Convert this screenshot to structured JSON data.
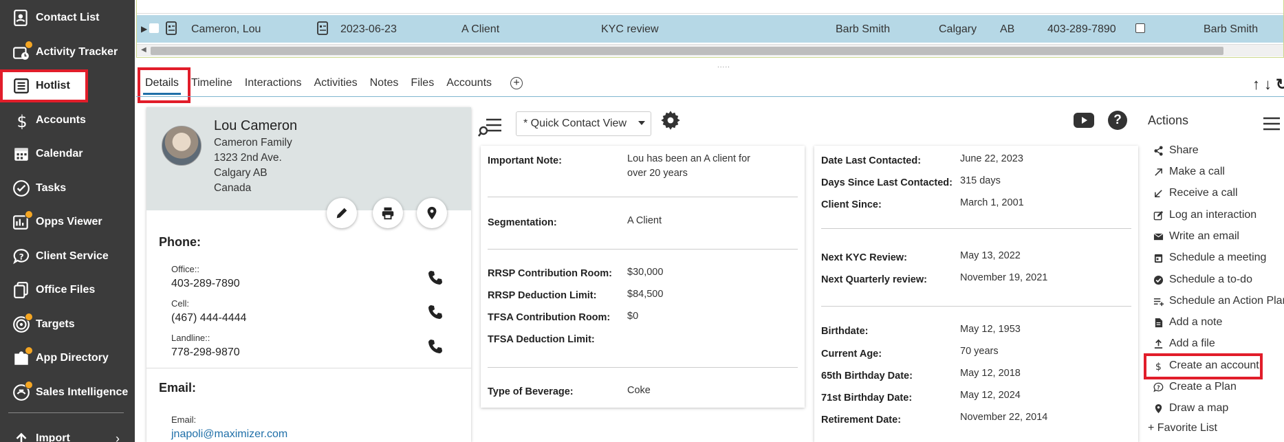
{
  "sidebar": {
    "items": [
      {
        "label": "Contact List",
        "icon": "contact-list-icon"
      },
      {
        "label": "Activity Tracker",
        "icon": "activity-tracker-icon"
      },
      {
        "label": "Hotlist",
        "icon": "hotlist-icon"
      },
      {
        "label": "Accounts",
        "icon": "dollar-icon"
      },
      {
        "label": "Calendar",
        "icon": "calendar-icon"
      },
      {
        "label": "Tasks",
        "icon": "check-circle-icon"
      },
      {
        "label": "Opps Viewer",
        "icon": "opps-viewer-icon"
      },
      {
        "label": "Client Service",
        "icon": "client-service-icon"
      },
      {
        "label": "Office Files",
        "icon": "office-files-icon"
      },
      {
        "label": "Targets",
        "icon": "target-icon"
      },
      {
        "label": "App Directory",
        "icon": "app-directory-icon"
      },
      {
        "label": "Sales Intelligence",
        "icon": "sales-intelligence-icon"
      },
      {
        "label": "Import",
        "icon": "import-icon"
      }
    ],
    "active": "Hotlist"
  },
  "grid": {
    "selected_row": {
      "name": "Cameron, Lou",
      "date": "2023-06-23",
      "segment": "A Client",
      "activity": "KYC review",
      "assigned": "Barb Smith",
      "city": "Calgary",
      "province": "AB",
      "phone": "403-289-7890",
      "owner": "Barb Smith"
    }
  },
  "tabs": [
    "Details",
    "Timeline",
    "Interactions",
    "Activities",
    "Notes",
    "Files",
    "Accounts"
  ],
  "contact": {
    "name": "Lou Cameron",
    "family": "Cameron Family",
    "address1": "1323 2nd Ave.",
    "city_prov": "Calgary AB",
    "country": "Canada",
    "phone_title": "Phone:",
    "phones": [
      {
        "label": "Office::",
        "value": "403-289-7890"
      },
      {
        "label": "Cell:",
        "value": "(467) 444-4444"
      },
      {
        "label": "Landline::",
        "value": "778-298-9870"
      }
    ],
    "email_title": "Email:",
    "email_label": "Email:",
    "email": "jnapoli@maximizer.com"
  },
  "toolbar": {
    "quick_view": "* Quick Contact View"
  },
  "panel_left": {
    "important_note_label": "Important Note:",
    "important_note_line1": "Lou has been an A client for",
    "important_note_line2": "over 20 years",
    "segmentation_label": "Segmentation:",
    "segmentation": "A Client",
    "rrsp_room_label": "RRSP Contribution Room:",
    "rrsp_room": "$30,000",
    "rrsp_limit_label": "RRSP Deduction Limit:",
    "rrsp_limit": "$84,500",
    "tfsa_room_label": "TFSA Contribution Room:",
    "tfsa_room": "$0",
    "tfsa_limit_label": "TFSA Deduction Limit:",
    "beverage_label": "Type of Beverage:",
    "beverage": "Coke"
  },
  "panel_right": {
    "last_contacted_label": "Date Last Contacted:",
    "last_contacted": "June 22, 2023",
    "days_since_label": "Days Since Last Contacted:",
    "days_since": "315 days",
    "client_since_label": "Client Since:",
    "client_since": "March 1, 2001",
    "next_kyc_label": "Next KYC Review:",
    "next_kyc": "May 13, 2022",
    "next_quarterly_label": "Next Quarterly review:",
    "next_quarterly": "November 19, 2021",
    "birthdate_label": "Birthdate:",
    "birthdate": "May 12, 1953",
    "age_label": "Current Age:",
    "age": "70 years",
    "b65_label": "65th Birthday Date:",
    "b65": "May 12, 2018",
    "b71_label": "71st Birthday Date:",
    "b71": "May 12, 2024",
    "retirement_label": "Retirement Date:",
    "retirement": "November 22, 2014"
  },
  "actions": {
    "title": "Actions",
    "items": [
      "Share",
      "Make a call",
      "Receive a call",
      "Log an interaction",
      "Write an email",
      "Schedule a meeting",
      "Schedule a to-do",
      "Schedule an Action Plan",
      "Add a note",
      "Add a file",
      "Create an account",
      "Create a Plan",
      "Draw a map"
    ],
    "favorite": "+ Favorite List"
  }
}
